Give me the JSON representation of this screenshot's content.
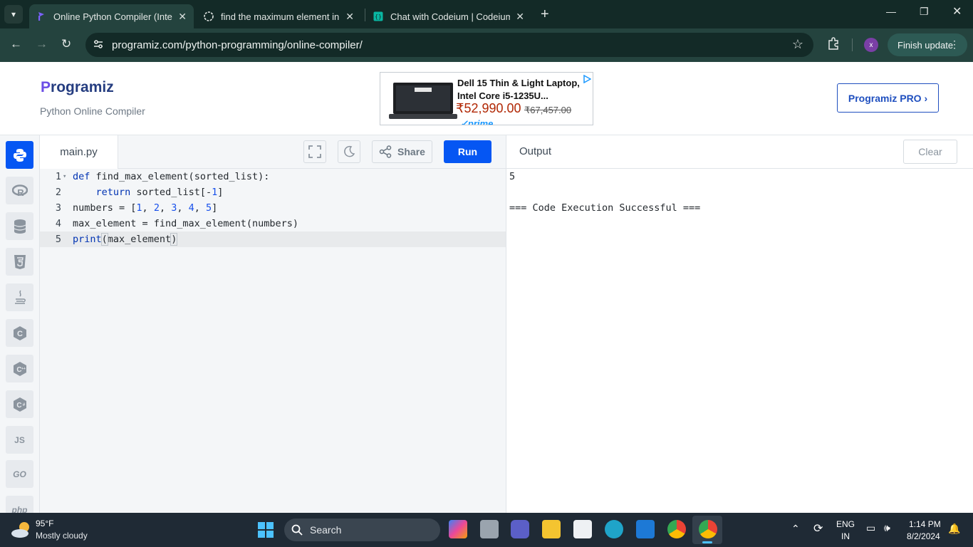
{
  "browser": {
    "tabs": [
      {
        "title": "Online Python Compiler (Interpreter)",
        "active": true
      },
      {
        "title": "find the maximum element in sorted list",
        "active": false
      },
      {
        "title": "Chat with Codeium | Codeium",
        "active": false
      }
    ],
    "url": "programiz.com/python-programming/online-compiler/",
    "profile_initial": "x",
    "finish_update_label": "Finish update"
  },
  "header": {
    "logo_text": "rogramiz",
    "logo_initial": "P",
    "tagline": "Python Online Compiler",
    "pro_button_label": "Programiz PRO ›",
    "ad": {
      "title_line1": "Dell 15 Thin & Light Laptop,",
      "title_line2": "Intel Core i5-1235U...",
      "price": "₹52,990.00",
      "mrp": "₹67,457.00",
      "prime": "✓prime"
    }
  },
  "rail": {
    "items": [
      {
        "icon": "python-icon",
        "active": true
      },
      {
        "icon": "r-icon",
        "active": false
      },
      {
        "icon": "database-icon",
        "active": false
      },
      {
        "icon": "html5-icon",
        "active": false
      },
      {
        "icon": "java-icon",
        "active": false
      },
      {
        "icon": "c-icon",
        "active": false
      },
      {
        "icon": "cpp-icon",
        "active": false
      },
      {
        "icon": "csharp-icon",
        "active": false
      },
      {
        "icon": "js-icon",
        "label": "JS",
        "active": false
      },
      {
        "icon": "go-icon",
        "label": "GO",
        "active": false
      },
      {
        "icon": "php-icon",
        "label": "php",
        "active": false
      }
    ]
  },
  "editor": {
    "filename": "main.py",
    "share_label": "Share",
    "run_label": "Run",
    "line_numbers": [
      "1",
      "2",
      "3",
      "4",
      "5"
    ],
    "current_line": 5,
    "code_lines": [
      "def find_max_element(sorted_list):",
      "    return sorted_list[-1]",
      "numbers = [1, 2, 3, 4, 5]",
      "max_element = find_max_element(numbers)",
      "print(max_element)"
    ]
  },
  "output": {
    "title": "Output",
    "clear_label": "Clear",
    "lines": [
      "5",
      "",
      "=== Code Execution Successful ==="
    ]
  },
  "taskbar": {
    "weather_temp": "95°F",
    "weather_desc": "Mostly cloudy",
    "search_placeholder": "Search",
    "language": "ENG",
    "region": "IN",
    "time": "1:14 PM",
    "date": "8/2/2024"
  },
  "colors": {
    "accent": "#0556f3",
    "chrome_dark": "#132a27",
    "chrome_toolbar": "#24433e"
  }
}
